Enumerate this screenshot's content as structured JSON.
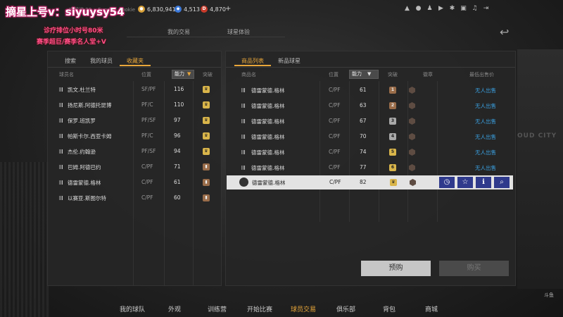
{
  "promo": {
    "line1": "摘星上号v：siyuysy54",
    "line2": "诊疗排位小时号80米",
    "line3": "赛季超巨/赛季名人堂+V"
  },
  "top": {
    "player_name": "宇智波·20  ...Sunday..Rookie",
    "currencies": [
      {
        "value": "6,830,941",
        "color": "#d9a23a",
        "icon": "coin-icon"
      },
      {
        "value": "4,513",
        "color": "#3b78d8",
        "icon": "diamond-icon"
      },
      {
        "value": "4,870",
        "color": "#c83a2a",
        "icon": "d-icon"
      }
    ],
    "add": "+"
  },
  "main_tabs": {
    "tab1": "我的交易",
    "tab2": "球星体验"
  },
  "left": {
    "tabs": [
      "搜索",
      "我的球员",
      "收藏夹"
    ],
    "headers": {
      "name": "球员名",
      "pos": "位置",
      "power": "能力",
      "break": "突破"
    },
    "rows": [
      {
        "name": "凯文.杜兰特",
        "pos": "SF/PF",
        "power": "116",
        "badge": "gold"
      },
      {
        "name": "扬尼斯.阿德托昆博",
        "pos": "PF/C",
        "power": "110",
        "badge": "gold"
      },
      {
        "name": "保罗.班凯罗",
        "pos": "PF/SF",
        "power": "97",
        "badge": "gold"
      },
      {
        "name": "帕斯卡尔.西亚卡姆",
        "pos": "PF/C",
        "power": "96",
        "badge": "gold"
      },
      {
        "name": "杰伦.约翰逊",
        "pos": "PF/SF",
        "power": "94",
        "badge": "gold"
      },
      {
        "name": "巴姆.阿德巴约",
        "pos": "C/PF",
        "power": "71",
        "badge": "bronze"
      },
      {
        "name": "德雷蒙德.格林",
        "pos": "C/PF",
        "power": "61",
        "badge": "bronze"
      },
      {
        "name": "以赛亚.斯图尔特",
        "pos": "C/PF",
        "power": "60",
        "badge": "bronze"
      }
    ]
  },
  "right": {
    "tabs": [
      "商品列表",
      "新品球星"
    ],
    "headers": {
      "name": "商品名",
      "pos": "位置",
      "power": "能力",
      "break": "突破",
      "emblem": "徽章",
      "price": "最低出售价"
    },
    "rows": [
      {
        "name": "德雷蒙德.格林",
        "pos": "C/PF",
        "power": "61",
        "level": "1",
        "price": "无人出售",
        "tone": "bronze"
      },
      {
        "name": "德雷蒙德.格林",
        "pos": "C/PF",
        "power": "63",
        "level": "2",
        "price": "无人出售",
        "tone": "bronze"
      },
      {
        "name": "德雷蒙德.格林",
        "pos": "C/PF",
        "power": "67",
        "level": "3",
        "price": "无人出售",
        "tone": "silver"
      },
      {
        "name": "德雷蒙德.格林",
        "pos": "C/PF",
        "power": "70",
        "level": "4",
        "price": "无人出售",
        "tone": "silver"
      },
      {
        "name": "德雷蒙德.格林",
        "pos": "C/PF",
        "power": "74",
        "level": "5",
        "price": "无人出售",
        "tone": "gold"
      },
      {
        "name": "德雷蒙德.格林",
        "pos": "C/PF",
        "power": "77",
        "level": "6",
        "price": "无人出售",
        "tone": "gold"
      }
    ],
    "selected": {
      "name": "德雷蒙德.格林",
      "pos": "C/PF",
      "power": "82"
    },
    "buttons": {
      "preorder": "预购",
      "buy": "购买"
    }
  },
  "nav": [
    "我的球队",
    "外观",
    "训练营",
    "开始比赛",
    "球员交易",
    "俱乐部",
    "背包",
    "商城"
  ],
  "logo": "斗鱼"
}
